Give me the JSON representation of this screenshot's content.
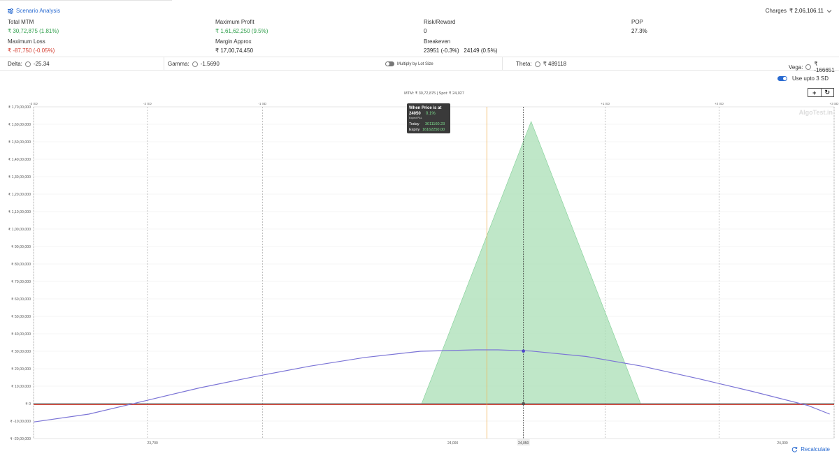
{
  "header": {
    "scenario_label": "Scenario Analysis",
    "charges_label": "Charges",
    "charges_value": "₹ 2,06,106.11"
  },
  "stats": {
    "total_mtm_label": "Total MTM",
    "total_mtm_value": "₹ 30,72,875 (1.81%)",
    "max_profit_label": "Maximum Profit",
    "max_profit_value": "₹ 1,61,62,250 (9.5%)",
    "risk_reward_label": "Risk/Reward",
    "risk_reward_value": "0",
    "pop_label": "POP",
    "pop_value": "27.3%",
    "max_loss_label": "Maximum Loss",
    "max_loss_value": "₹ -87,750 (-0.05%)",
    "margin_label": "Margin Approx",
    "margin_value": "₹ 17,00,74,450",
    "breakeven_label": "Breakeven",
    "breakeven_value": "23951 (-0.3%)   24149 (0.5%)"
  },
  "greeks": {
    "delta_label": "Delta:",
    "delta_value": "-25.34",
    "gamma_label": "Gamma:",
    "gamma_value": "-1.5690",
    "lot_toggle_label": "Multiply by Lot Size",
    "theta_label": "Theta:",
    "theta_value": "₹ 489118",
    "vega_label": "Vega:",
    "vega_value": "₹ -166651"
  },
  "sd_toggle_label": "Use upto 3 SD",
  "recalculate_label": "Recalculate",
  "watermark": "AlgoTest.in",
  "top_readout": "MTM: ₹ 30,72,875  |  Spot: ₹ 24,027",
  "crosshair_label": "24,050",
  "tooltip": {
    "title": "When Price is at",
    "price": "24050",
    "pct": "0.1%",
    "sub": "Expect P&L",
    "today_label": "Today",
    "today_value": "3011160.23",
    "expiry_label": "Expiry",
    "expiry_value": "16162250.00"
  },
  "colors": {
    "accent": "#2a6bd1",
    "profit": "#2e9e4a",
    "loss": "#d33a2c",
    "today_curve": "#7b74d6",
    "expiry_fill": "#a9dfb6"
  },
  "chart_data": {
    "type": "area",
    "x_range": [
      23600,
      24200
    ],
    "ylim": [
      -2000000,
      17000000
    ],
    "y_ticks": [
      {
        "v": 17000000,
        "label": "₹ 1,70,00,000"
      },
      {
        "v": 16000000,
        "label": "₹ 1,60,00,000"
      },
      {
        "v": 15000000,
        "label": "₹ 1,50,00,000"
      },
      {
        "v": 14000000,
        "label": "₹ 1,40,00,000"
      },
      {
        "v": 13000000,
        "label": "₹ 1,30,00,000"
      },
      {
        "v": 12000000,
        "label": "₹ 1,20,00,000"
      },
      {
        "v": 11000000,
        "label": "₹ 1,10,00,000"
      },
      {
        "v": 10000000,
        "label": "₹ 1,00,00,000"
      },
      {
        "v": 9000000,
        "label": "₹ 90,00,000"
      },
      {
        "v": 8000000,
        "label": "₹ 80,00,000"
      },
      {
        "v": 7000000,
        "label": "₹ 70,00,000"
      },
      {
        "v": 6000000,
        "label": "₹ 60,00,000"
      },
      {
        "v": 5000000,
        "label": "₹ 50,00,000"
      },
      {
        "v": 4000000,
        "label": "₹ 40,00,000"
      },
      {
        "v": 3000000,
        "label": "₹ 30,00,000"
      },
      {
        "v": 2000000,
        "label": "₹ 20,00,000"
      },
      {
        "v": 1000000,
        "label": "₹ 10,00,000"
      },
      {
        "v": 0,
        "label": "₹ 0"
      },
      {
        "v": -1000000,
        "label": "₹ -10,00,000"
      },
      {
        "v": -2000000,
        "label": "₹ -20,00,000"
      }
    ],
    "x_ticks": [
      {
        "v": 23700,
        "label": "23,700"
      },
      {
        "v": 24000,
        "label": "24,000"
      },
      {
        "v": 24300,
        "label": "24,300"
      }
    ],
    "sd_lines": [
      {
        "v": 23600,
        "label": "-3 SD"
      },
      {
        "v": 23703,
        "label": "-2 SD"
      },
      {
        "v": 23807,
        "label": "-1 SD"
      },
      {
        "v": 24117,
        "label": "+1 SD"
      },
      {
        "v": 24220,
        "label": "+2 SD"
      },
      {
        "v": 24324,
        "label": "+3 SD"
      }
    ],
    "spot": 24027,
    "crosshair_x": 24050,
    "expiry_series": {
      "name": "Expiry",
      "x": [
        23600,
        23951,
        24050,
        24149,
        24320
      ],
      "y": [
        -87750,
        0,
        16162250,
        0,
        -87750
      ]
    },
    "today_series": {
      "name": "Today",
      "x": [
        23600,
        23650,
        23700,
        23750,
        23800,
        23850,
        23900,
        23950,
        24000,
        24020,
        24050,
        24100,
        24150,
        24200,
        24250,
        24300,
        24320
      ],
      "y": [
        -1050000,
        -600000,
        150000,
        900000,
        1550000,
        2150000,
        2650000,
        3000000,
        3080000,
        3080000,
        3011160,
        2700000,
        2150000,
        1450000,
        700000,
        -100000,
        -600000
      ]
    }
  }
}
